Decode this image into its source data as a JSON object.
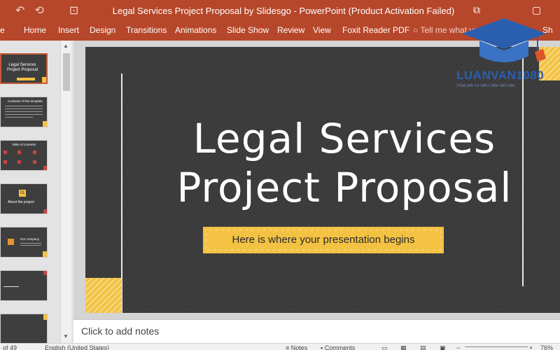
{
  "window": {
    "title": "Legal Services Project Proposal by Slidesgo - PowerPoint (Product Activation Failed)",
    "qat": [
      "↶",
      "⟲",
      "⊡"
    ],
    "controls": [
      "⧉",
      "▢"
    ]
  },
  "ribbon": {
    "partial_first_tab": "e",
    "tabs": [
      "Home",
      "Insert",
      "Design",
      "Transitions",
      "Animations",
      "Slide Show",
      "Review",
      "View",
      "Foxit Reader PDF"
    ],
    "tell_me": "Tell me what yo",
    "share": "Sh"
  },
  "thumbnails": [
    {
      "title": "Legal Services Project Proposal",
      "active": true
    },
    {
      "title": "Contents of this template",
      "active": false
    },
    {
      "title": "Table of contents",
      "active": false
    },
    {
      "title": "About the project",
      "badge": "01",
      "active": false
    },
    {
      "title": "Our company",
      "active": false
    },
    {
      "title": "",
      "active": false
    },
    {
      "title": "",
      "active": false
    }
  ],
  "slide": {
    "title_line1": "Legal Services",
    "title_line2": "Project Proposal",
    "subtitle": "Here is where your presentation begins"
  },
  "notes": {
    "placeholder": "Click to add notes"
  },
  "status": {
    "slide_count": "of 49",
    "language": "English (United States)",
    "notes_label": "Notes",
    "comments_label": "Comments",
    "zoom": "76%"
  },
  "watermark": {
    "brand": "LUANVAN1080",
    "tagline": "TỔNG ĐÀI TƯ VẤN LUẬN VĂN 1080"
  },
  "colors": {
    "accent": "#b7472a",
    "slide_bg": "#3a3a3a",
    "yellow": "#f3c242",
    "red": "#c84343"
  }
}
